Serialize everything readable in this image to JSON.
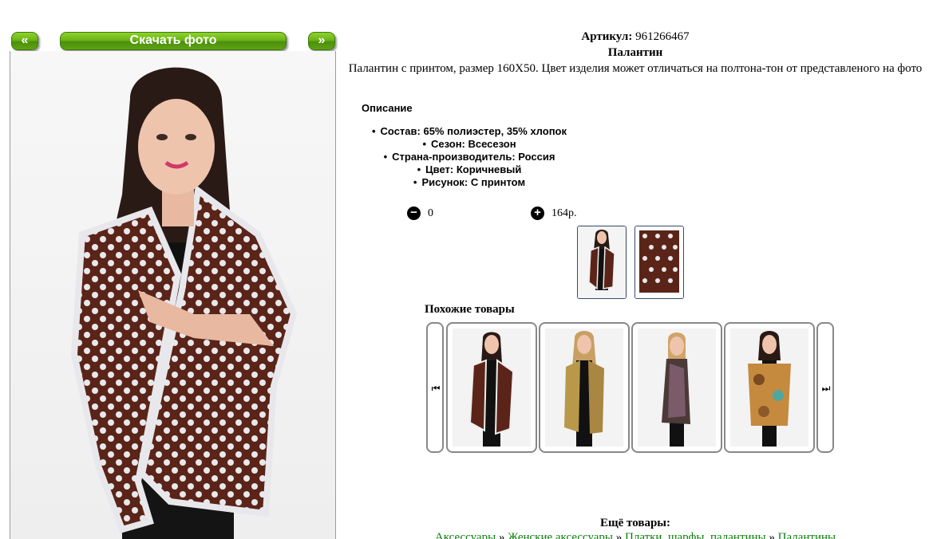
{
  "nav": {
    "prev_label": "«",
    "next_label": "»",
    "download_label": "Скачать фото"
  },
  "product": {
    "sku_label": "Артикул:",
    "sku_value": "961266467",
    "title": "Палантин",
    "description": "Палантин с принтом, размер 160Х50. Цвет изделия может отличаться на полтона-тон от представленого на фото",
    "section_heading": "Описание",
    "attributes": [
      "Состав: 65% полиэстер, 35% хлопок",
      "Сезон: Всесезон",
      "Страна-производитель: Россия",
      "Цвет: Коричневый",
      "Рисунок: С принтом"
    ]
  },
  "cart": {
    "quantity": "0",
    "price": "164р.",
    "minus_icon": "minus-circle-icon",
    "plus_icon": "plus-circle-icon"
  },
  "similar": {
    "heading": "Похожие товары"
  },
  "more": {
    "heading": "Ещё товары:",
    "breadcrumb": [
      "Аксессуары",
      "Женские аксессуары",
      "Платки, шарфы, палантины",
      "Палантины"
    ],
    "separator": "»"
  },
  "colors": {
    "button_green": "#6bb417",
    "scarf_brown": "#5a2418",
    "link_green": "#0a7d0a",
    "thumb_border": "#324b6b"
  }
}
